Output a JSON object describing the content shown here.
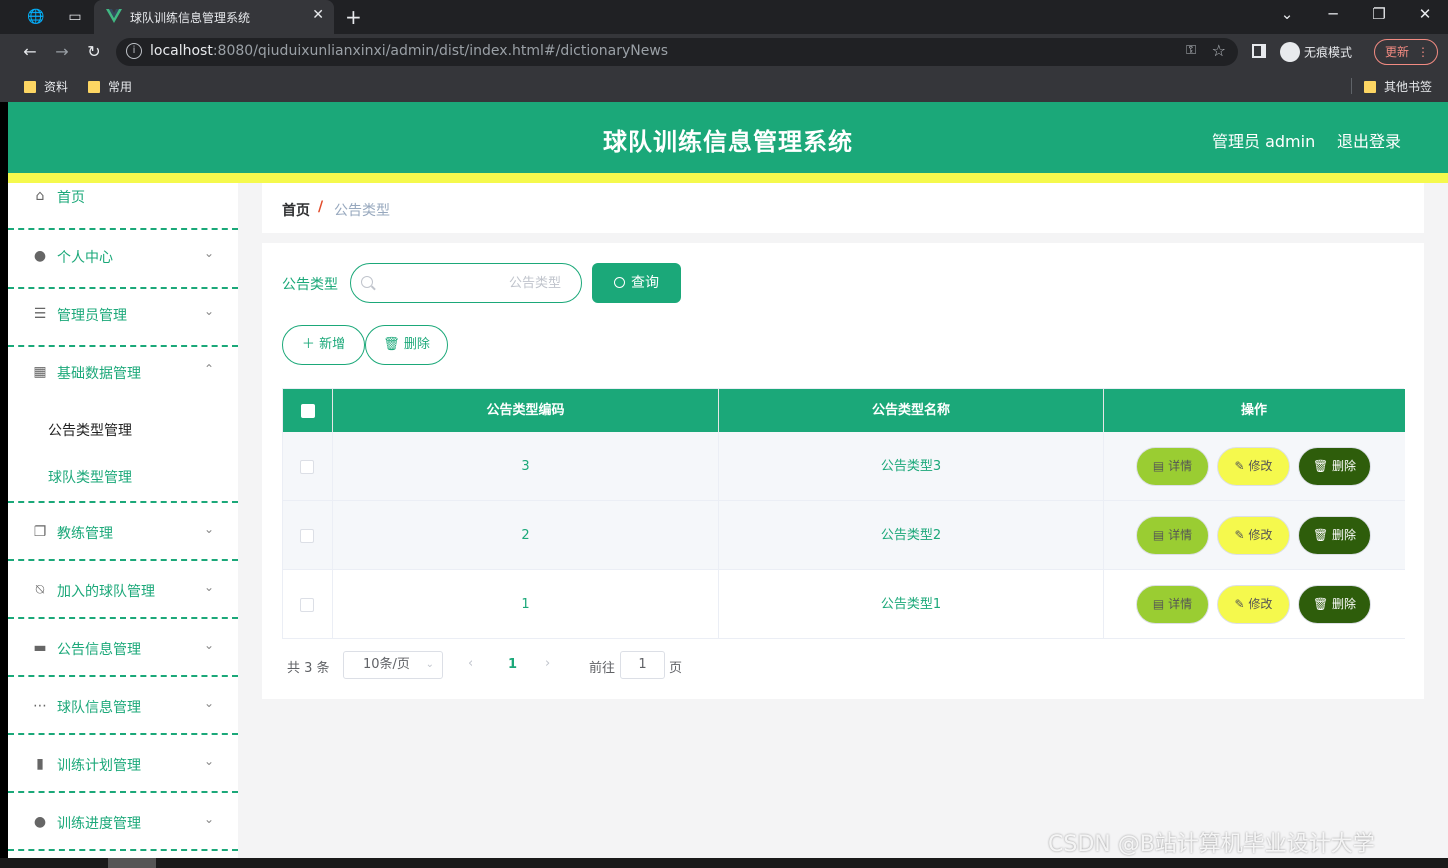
{
  "browser": {
    "tab_title": "球队训练信息管理系统",
    "url_host": "localhost",
    "url_rest": ":8080/qiuduixunlianxinxi/admin/dist/index.html#/dictionaryNews",
    "incognito_label": "无痕模式",
    "update_label": "更新",
    "bookmarks": [
      "资料",
      "常用"
    ],
    "other_bookmarks": "其他书签"
  },
  "header": {
    "title": "球队训练信息管理系统",
    "user": "管理员 admin",
    "logout": "退出登录",
    "colors": {
      "primary": "#1ba879",
      "accent_strip": "#f5f94d"
    }
  },
  "sidebar": {
    "items": [
      {
        "label": "首页",
        "icon": "home-icon"
      },
      {
        "label": "个人中心",
        "icon": "user-icon"
      },
      {
        "label": "管理员管理",
        "icon": "list-icon"
      },
      {
        "label": "基础数据管理",
        "icon": "grid-icon",
        "expanded": true
      },
      {
        "label": "教练管理",
        "icon": "copy-icon"
      },
      {
        "label": "加入的球队管理",
        "icon": "bell-off-icon"
      },
      {
        "label": "公告信息管理",
        "icon": "chat-icon"
      },
      {
        "label": "球队信息管理",
        "icon": "chat-dots-icon"
      },
      {
        "label": "训练计划管理",
        "icon": "notebook-icon"
      },
      {
        "label": "训练进度管理",
        "icon": "user-icon"
      }
    ],
    "sub_items": [
      {
        "label": "公告类型管理",
        "active": true
      },
      {
        "label": "球队类型管理",
        "active": false
      }
    ]
  },
  "breadcrumb": {
    "home": "首页",
    "separator": "/",
    "current": "公告类型"
  },
  "search": {
    "label": "公告类型",
    "placeholder": "公告类型",
    "button": "查询"
  },
  "actions": {
    "add": "新增",
    "delete": "删除"
  },
  "table": {
    "columns": [
      "公告类型编码",
      "公告类型名称",
      "操作"
    ],
    "rows": [
      {
        "code": "3",
        "name": "公告类型3"
      },
      {
        "code": "2",
        "name": "公告类型2"
      },
      {
        "code": "1",
        "name": "公告类型1"
      }
    ],
    "row_actions": {
      "detail": "详情",
      "edit": "修改",
      "delete": "删除"
    }
  },
  "pagination": {
    "total": "共 3 条",
    "page_size": "10条/页",
    "current_page": "1",
    "goto_prefix": "前往",
    "goto_value": "1",
    "goto_suffix": "页"
  },
  "watermark": "CSDN @B站计算机毕业设计大学"
}
